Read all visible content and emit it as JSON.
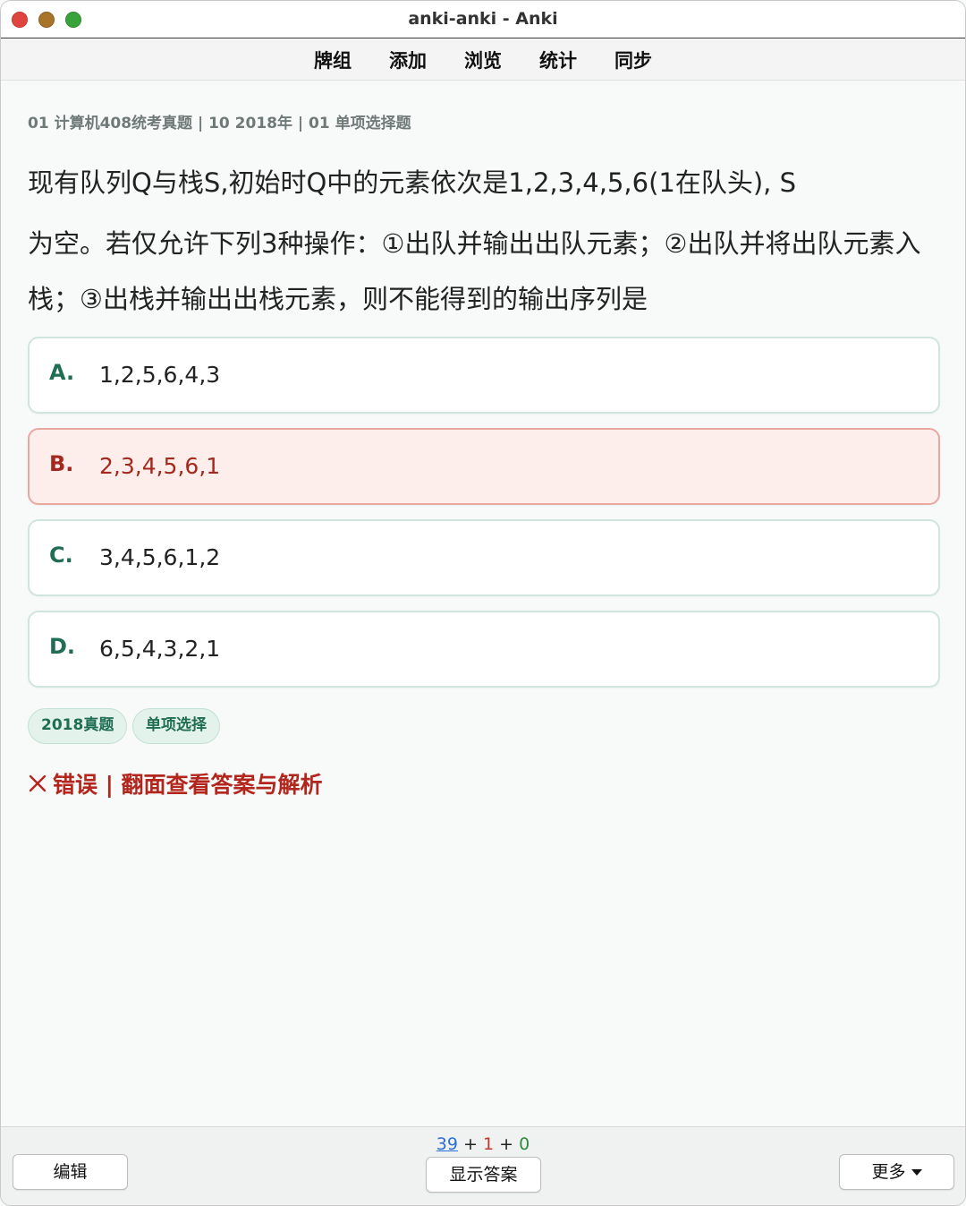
{
  "window": {
    "title": "anki-anki - Anki"
  },
  "toolbar": {
    "items": [
      {
        "label": "牌组"
      },
      {
        "label": "添加"
      },
      {
        "label": "浏览"
      },
      {
        "label": "统计"
      },
      {
        "label": "同步"
      }
    ]
  },
  "card": {
    "breadcrumb": "01 计算机408统考真题 | 10 2018年 | 01 单项选择题",
    "question_line1": "现有队列Q与栈S,初始时Q中的元素依次是1,2,3,4,5,6(1在队头), S",
    "question_rest": "为空。若仅允许下列3种操作：①出队并输出出队元素；②出队并将出队元素入栈；③出栈并输出出栈元素，则不能得到的输出序列是",
    "options": [
      {
        "letter": "A.",
        "text": "1,2,5,6,4,3",
        "state": "normal"
      },
      {
        "letter": "B.",
        "text": "2,3,4,5,6,1",
        "state": "wrong"
      },
      {
        "letter": "C.",
        "text": "3,4,5,6,1,2",
        "state": "normal"
      },
      {
        "letter": "D.",
        "text": "6,5,4,3,2,1",
        "state": "normal"
      }
    ],
    "tags": [
      "2018真题",
      "单项选择"
    ],
    "result_text": "错误 | 翻面查看答案与解析",
    "colors": {
      "wrong": "#b3261e",
      "accent": "#1f6e53"
    }
  },
  "bottom": {
    "count_new": "39",
    "count_learn": "1",
    "count_review": "0",
    "plus": "+",
    "edit_label": "编辑",
    "show_answer_label": "显示答案",
    "more_label": "更多"
  }
}
